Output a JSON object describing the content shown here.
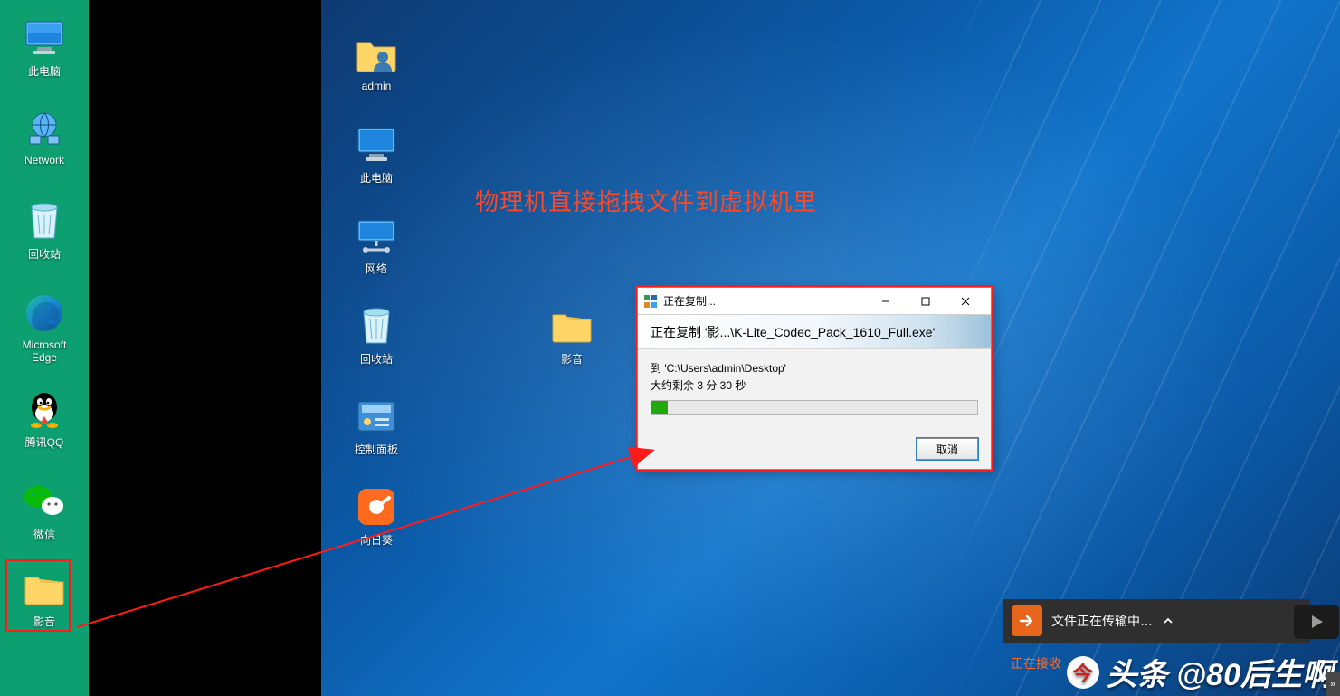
{
  "host_desktop": {
    "items": [
      {
        "label": "此电脑",
        "icon": "pc"
      },
      {
        "label": "Network",
        "icon": "network"
      },
      {
        "label": "回收站",
        "icon": "recycle"
      },
      {
        "label": "Microsoft\nEdge",
        "icon": "edge"
      },
      {
        "label": "腾讯QQ",
        "icon": "qq"
      },
      {
        "label": "微信",
        "icon": "wechat"
      },
      {
        "label": "影音",
        "icon": "folder"
      }
    ]
  },
  "guest_desktop": {
    "items": [
      {
        "label": "admin",
        "icon": "user-folder"
      },
      {
        "label": "此电脑",
        "icon": "pc"
      },
      {
        "label": "网络",
        "icon": "network"
      },
      {
        "label": "回收站",
        "icon": "recycle"
      },
      {
        "label": "控制面板",
        "icon": "control-panel"
      },
      {
        "label": "向日葵",
        "icon": "sunlogin"
      }
    ],
    "dropped_folder_label": "影音"
  },
  "annotation": {
    "headline": "物理机直接拖拽文件到虚拟机里"
  },
  "copy_dialog": {
    "title": "正在复制...",
    "header": "正在复制 '影...\\K-Lite_Codec_Pack_1610_Full.exe'",
    "dest_line": "到 'C:\\Users\\admin\\Desktop'",
    "eta_line": "大约剩余 3 分 30 秒",
    "progress_percent": 5,
    "cancel_label": "取消"
  },
  "transfer_bar": {
    "text": "文件正在传输中…"
  },
  "recv_status": "正在接收",
  "watermark": "头条 @80后生啊",
  "colors": {
    "annotation_red": "#ff1b1a"
  }
}
